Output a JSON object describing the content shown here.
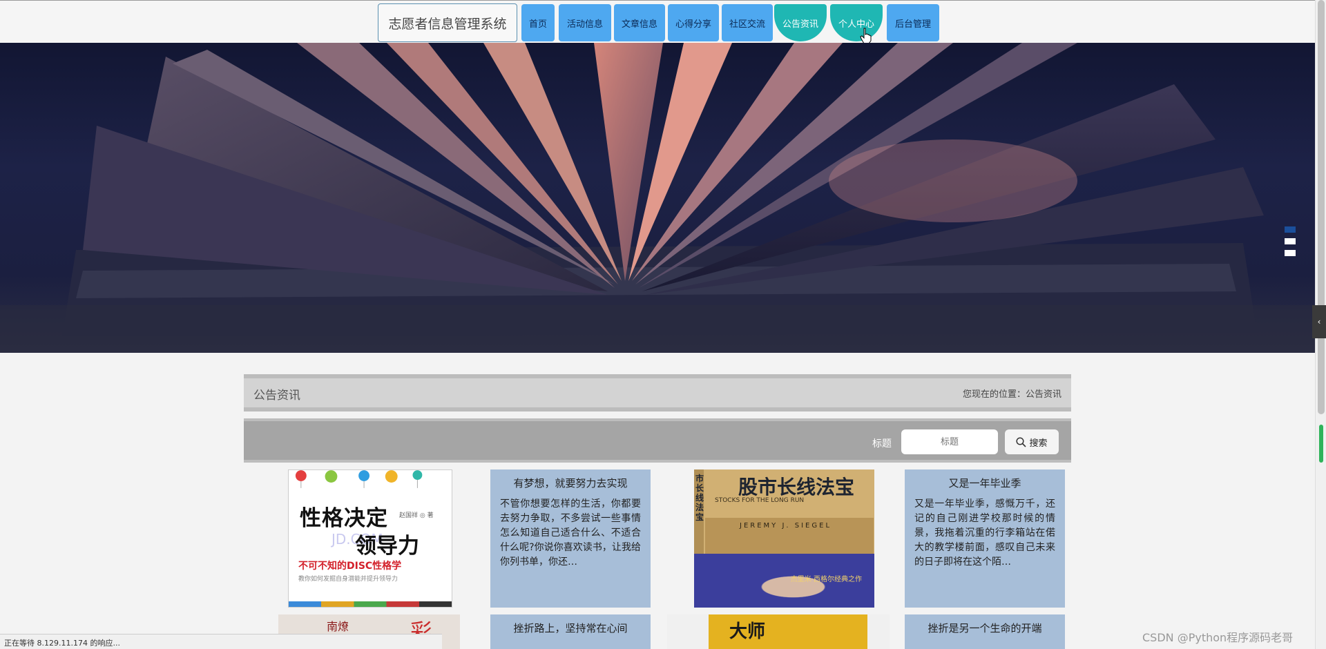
{
  "header": {
    "brand": "志愿者信息管理系统",
    "nav": [
      {
        "label": "首页",
        "active": false
      },
      {
        "label": "活动信息",
        "active": false
      },
      {
        "label": "文章信息",
        "active": false
      },
      {
        "label": "心得分享",
        "active": false
      },
      {
        "label": "社区交流",
        "active": false
      },
      {
        "label": "公告资讯",
        "active": true
      },
      {
        "label": "个人中心",
        "active": true
      },
      {
        "label": "后台管理",
        "active": false
      }
    ]
  },
  "banner": {
    "slides": 3,
    "active_slide": 1
  },
  "section": {
    "title": "公告资讯",
    "breadcrumb": "您现在的位置：公告资讯"
  },
  "search": {
    "label": "标题",
    "placeholder": "标题",
    "button": "搜索"
  },
  "cards": [
    {
      "type": "image",
      "title": "性格决定领导力",
      "title_top": "性格决定",
      "title_bottom": "领导力",
      "subtitle": "不可不知的DISC性格学",
      "desc": "教你如何发掘自身潜能并提升领导力",
      "author": "赵国祥 ◎ 著",
      "watermark": "JD.COM"
    },
    {
      "type": "text",
      "title": "有梦想，就要努力去实现",
      "body": "不管你想要怎样的生活，你都要去努力争取，不多尝试一些事情怎么知道自己适合什么、不适合什么呢?你说你喜欢读书，让我给你列书单，你还…"
    },
    {
      "type": "image",
      "title": "股市长线法宝",
      "side": "市长线法宝",
      "subtitle": "STOCKS FOR THE LONG RUN",
      "author": "JEREMY J. SIEGEL",
      "photo_text": "杰里米·西格尔经典之作"
    },
    {
      "type": "text",
      "title": "又是一年毕业季",
      "body": "又是一年毕业季，感慨万千，还记的自己刚进学校那时候的情景，我拖着沉重的行李箱站在偌大的教学楼前面，感叹自己未来的日子即将在这个陌…"
    },
    {
      "type": "image",
      "title": "南燎",
      "glyph": "彩"
    },
    {
      "type": "text",
      "title": "挫折路上，坚持常在心间",
      "body": ""
    },
    {
      "type": "image",
      "title": "大师",
      "side": "大师"
    },
    {
      "type": "text",
      "title": "挫折是另一个生命的开端",
      "body": ""
    }
  ],
  "statusbar": {
    "text": "正在等待 8.129.11.174 的响应..."
  },
  "watermark": {
    "text": "CSDN @Python程序源码老哥"
  },
  "colors": {
    "nav_blue": "#4ea8f0",
    "nav_teal": "#1fb7b3",
    "card_blue": "#a7bed8",
    "title_bar": "#d3d3d3",
    "search_bar": "#a5a5a5"
  }
}
